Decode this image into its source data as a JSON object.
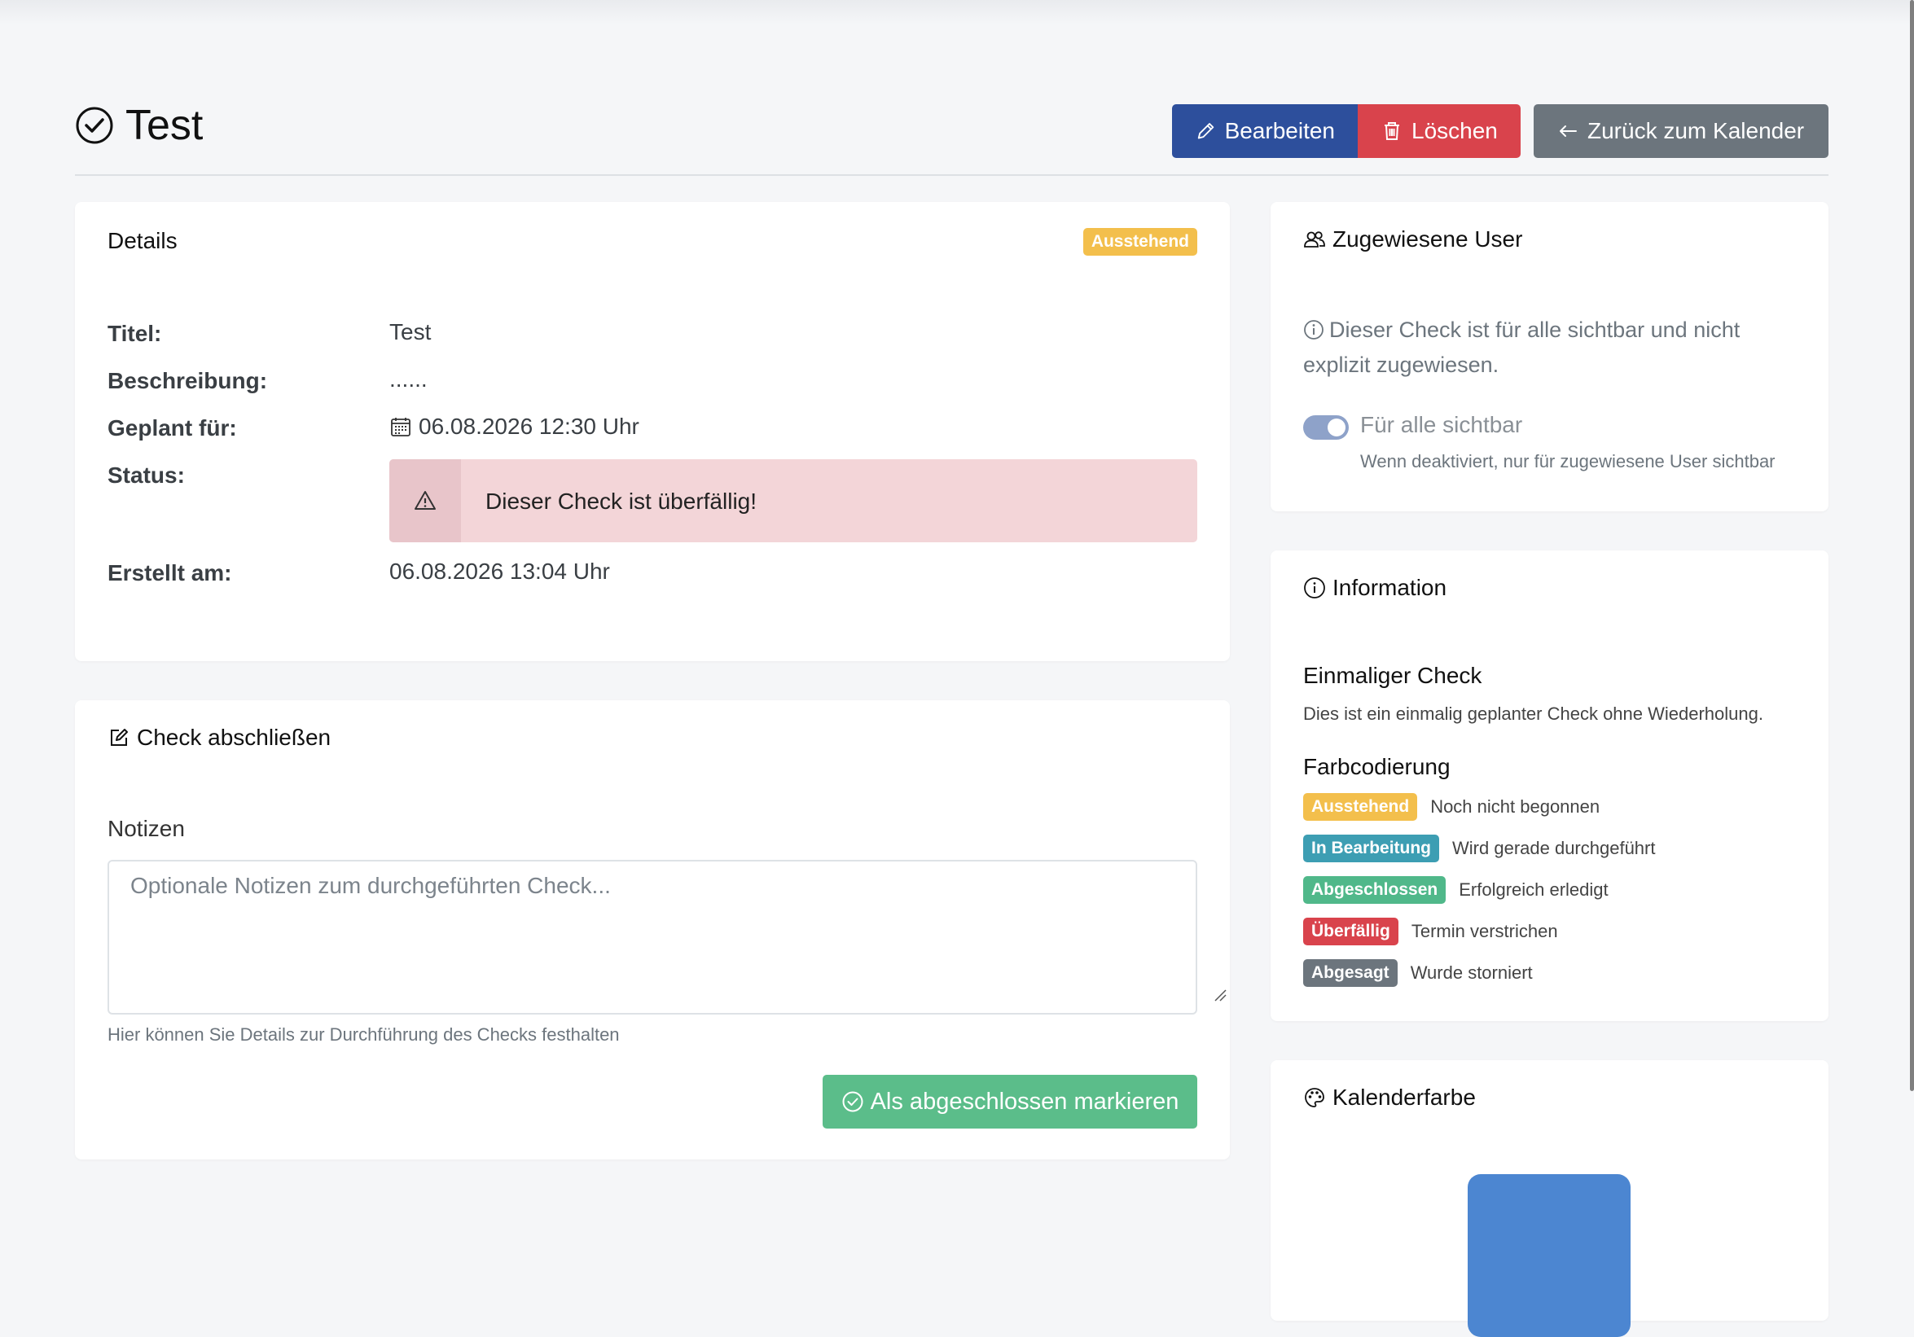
{
  "page": {
    "title": "Test",
    "title_icon": "check-circle-icon"
  },
  "toolbar": {
    "edit_label": "Bearbeiten",
    "delete_label": "Löschen",
    "back_label": "Zurück zum Kalender"
  },
  "details": {
    "heading": "Details",
    "status_badge": "Ausstehend",
    "labels": {
      "title": "Titel:",
      "description": "Beschreibung:",
      "scheduled": "Geplant für:",
      "status": "Status:",
      "created": "Erstellt am:"
    },
    "values": {
      "title": "Test",
      "description": "......",
      "scheduled": "06.08.2026 12:30 Uhr",
      "status_alert": "Dieser Check ist überfällig!",
      "created": "06.08.2026 13:04 Uhr"
    }
  },
  "complete_check": {
    "heading": "Check abschließen",
    "notes_label": "Notizen",
    "notes_value": "",
    "notes_placeholder": "Optionale Notizen zum durchgeführten Check...",
    "notes_help": "Hier können Sie Details zur Durchführung des Checks festhalten",
    "submit_label": "Als abgeschlossen markieren"
  },
  "assigned_users": {
    "heading": "Zugewiesene User",
    "info_text": "Dieser Check ist für alle sichtbar und nicht explizit zugewiesen.",
    "toggle_on": true,
    "toggle_label": "Für alle sichtbar",
    "toggle_help": "Wenn deaktiviert, nur für zugewiesene User sichtbar"
  },
  "information": {
    "heading": "Information",
    "type_heading": "Einmaliger Check",
    "type_desc": "Dies ist ein einmalig geplanter Check ohne Wiederholung.",
    "legend_heading": "Farbcodierung",
    "legend": [
      {
        "badge": "Ausstehend",
        "desc": "Noch nicht begonnen",
        "color": "#f3bf4c"
      },
      {
        "badge": "In Bearbeitung",
        "desc": "Wird gerade durchgeführt",
        "color": "#3d9eb3"
      },
      {
        "badge": "Abgeschlossen",
        "desc": "Erfolgreich erledigt",
        "color": "#50b88a"
      },
      {
        "badge": "Überfällig",
        "desc": "Termin verstrichen",
        "color": "#d9434c"
      },
      {
        "badge": "Abgesagt",
        "desc": "Wurde storniert",
        "color": "#6c757d"
      }
    ]
  },
  "calendar_color": {
    "heading": "Kalenderfarbe",
    "color": "#4c86d1"
  }
}
